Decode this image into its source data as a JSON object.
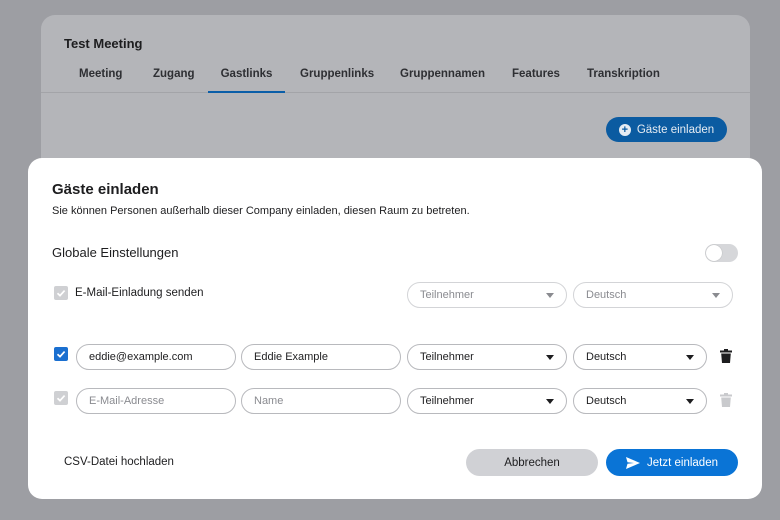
{
  "background": {
    "title": "Test Meeting",
    "tabs": [
      {
        "label": "Meeting",
        "active": false
      },
      {
        "label": "Zugang",
        "active": false
      },
      {
        "label": "Gastlinks",
        "active": true
      },
      {
        "label": "Gruppenlinks",
        "active": false
      },
      {
        "label": "Gruppennamen",
        "active": false
      },
      {
        "label": "Features",
        "active": false
      },
      {
        "label": "Transkription",
        "active": false
      }
    ],
    "invite_button_label": "Gäste einladen"
  },
  "modal": {
    "title": "Gäste einladen",
    "description": "Sie können Personen außerhalb dieser Company einladen, diesen Raum zu betreten.",
    "global_settings": {
      "label": "Globale Einstellungen",
      "enabled": false,
      "send_email_label": "E-Mail-Einladung senden",
      "send_email_checked": true,
      "role": "Teilnehmer",
      "language": "Deutsch"
    },
    "guests": [
      {
        "checked": true,
        "email": "eddie@example.com",
        "name": "Eddie Example",
        "role": "Teilnehmer",
        "language": "Deutsch"
      },
      {
        "checked": true,
        "email_placeholder": "E-Mail-Adresse",
        "name_placeholder": "Name",
        "role": "Teilnehmer",
        "language": "Deutsch"
      }
    ],
    "csv_upload_label": "CSV-Datei hochladen",
    "cancel_label": "Abbrechen",
    "submit_label": "Jetzt einladen"
  },
  "colors": {
    "accent": "#0a74d6",
    "overlay": "#9d9ea3"
  }
}
